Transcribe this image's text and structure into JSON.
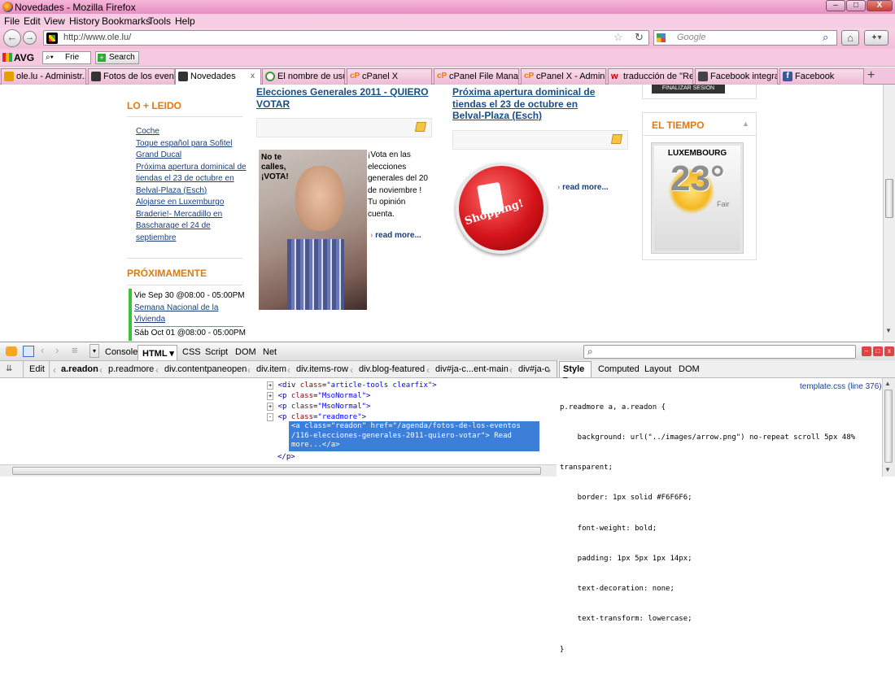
{
  "window": {
    "title": "Novedades - Mozilla Firefox",
    "min": "–",
    "max": "□",
    "close": "X"
  },
  "menu": [
    "File",
    "Edit",
    "View",
    "History",
    "Bookmarks",
    "Tools",
    "Help"
  ],
  "nav": {
    "back": "←",
    "forward": "→",
    "url": "http://www.ole.lu/",
    "search_placeholder": "Google",
    "star": "☆",
    "reload": "↻",
    "home": "⌂"
  },
  "avg": {
    "label": "AVG",
    "combo": "Frie",
    "search_label": "Search"
  },
  "tabs": [
    {
      "label": "ole.lu - Administr...",
      "color": "#e8a000"
    },
    {
      "label": "Fotos de los event...",
      "color": "#333333"
    },
    {
      "label": "Novedades",
      "color": "#333333"
    },
    {
      "label": "El nombre de usu...",
      "color": "#3a9a3a"
    },
    {
      "label": "cPanel X",
      "color": "#f07a00"
    },
    {
      "label": "cPanel File Mana...",
      "color": "#f07a00"
    },
    {
      "label": "cPanel X - Admini...",
      "color": "#f07a00"
    },
    {
      "label": "traducción de \"Re...",
      "color": "#c00000"
    },
    {
      "label": "Facebook integrat...",
      "color": "#444444"
    },
    {
      "label": "Facebook",
      "color": "#3b5998"
    }
  ],
  "new_tab": "+",
  "sidebar": {
    "lo_mas_leido_title": "LO + LEIDO",
    "links": [
      "Coche",
      "Toque español para Sofitel",
      "Grand Ducal",
      "Próxima apertura dominical de",
      "tiendas el 23 de octubre en",
      "Belval-Plaza (Esch)",
      "Alojarse en Luxemburgo",
      "Braderie!- Mercadillo en",
      "Bascharage el 24 de",
      "septiembre"
    ],
    "proximamente_title": "PRÓXIMAMENTE",
    "event1_date": "Vie Sep 30 @08:00 - 05:00PM",
    "event1_title_line1": "Semana Nacional de la",
    "event1_title_line2": "Vivienda",
    "event2_date": "Sáb Oct 01 @08:00 - 05:00PM"
  },
  "article1": {
    "title_line1": "Elecciones Generales 2011 - QUIERO",
    "title_line2": "VOTAR",
    "image_sign_line1": "No te",
    "image_sign_line2": "calles,",
    "image_sign_line3": "¡VOTA!",
    "text": [
      "¡Vota en las",
      "elecciones",
      "generales del 20",
      "de noviembre !",
      "Tu opinión",
      "cuenta."
    ],
    "readmore": "read more..."
  },
  "article2": {
    "title_line1": "Próxima apertura dominical de",
    "title_line2": "tiendas el 23 de octubre en",
    "title_line3": "Belval-Plaza (Esch)",
    "image_text": "Shopping!",
    "readmore": "read more..."
  },
  "right": {
    "logout": "FINALIZAR SESION",
    "weather_title": "EL TIEMPO",
    "city": "LUXEMBOURG",
    "temp": "23°",
    "condition": "Fair"
  },
  "firebug": {
    "tabs": [
      "Console",
      "HTML",
      "CSS",
      "Script",
      "DOM",
      "Net"
    ],
    "active_tab": "HTML",
    "search_placeholder": "",
    "edit": "Edit",
    "breadcrumb": [
      "a.readon",
      "p.readmore",
      "div.contentpaneopen",
      "div.item",
      "div.items-row",
      "div.blog-featured",
      "div#ja-c...ent-main",
      "div#ja-c"
    ],
    "html_lines": [
      {
        "pre": "<div ",
        "attr": "class",
        "val": "\"article-tools clearfix\"",
        "post": ">"
      },
      {
        "pre": "<p ",
        "attr": "class",
        "val": "\"MsoNormal\"",
        "post": ">"
      },
      {
        "pre": "<p ",
        "attr": "class",
        "val": "\"MsoNormal\"",
        "post": ">"
      },
      {
        "pre": "<p ",
        "attr": "class",
        "val": "\"readmore\"",
        "post": ">"
      }
    ],
    "selected_line1": "<a class=\"readon\" href=\"/agenda/fotos-de-los-eventos",
    "selected_line2": "/116-elecciones-generales-2011-quiero-votar\"> Read",
    "selected_line3": "more...</a>",
    "close_p": "</p>",
    "side_tabs": [
      "Style",
      "Computed",
      "Layout",
      "DOM"
    ],
    "active_side_tab": "Style",
    "css_source": "template.css (line 376)",
    "css_lines": [
      "p.readmore a, a.readon {",
      "    background: url(\"../images/arrow.png\") no-repeat scroll 5px 48%",
      "transparent;",
      "    border: 1px solid #F6F6F6;",
      "    font-weight: bold;",
      "    padding: 1px 5px 1px 14px;",
      "    text-decoration: none;",
      "    text-transform: lowercase;",
      "}"
    ]
  }
}
